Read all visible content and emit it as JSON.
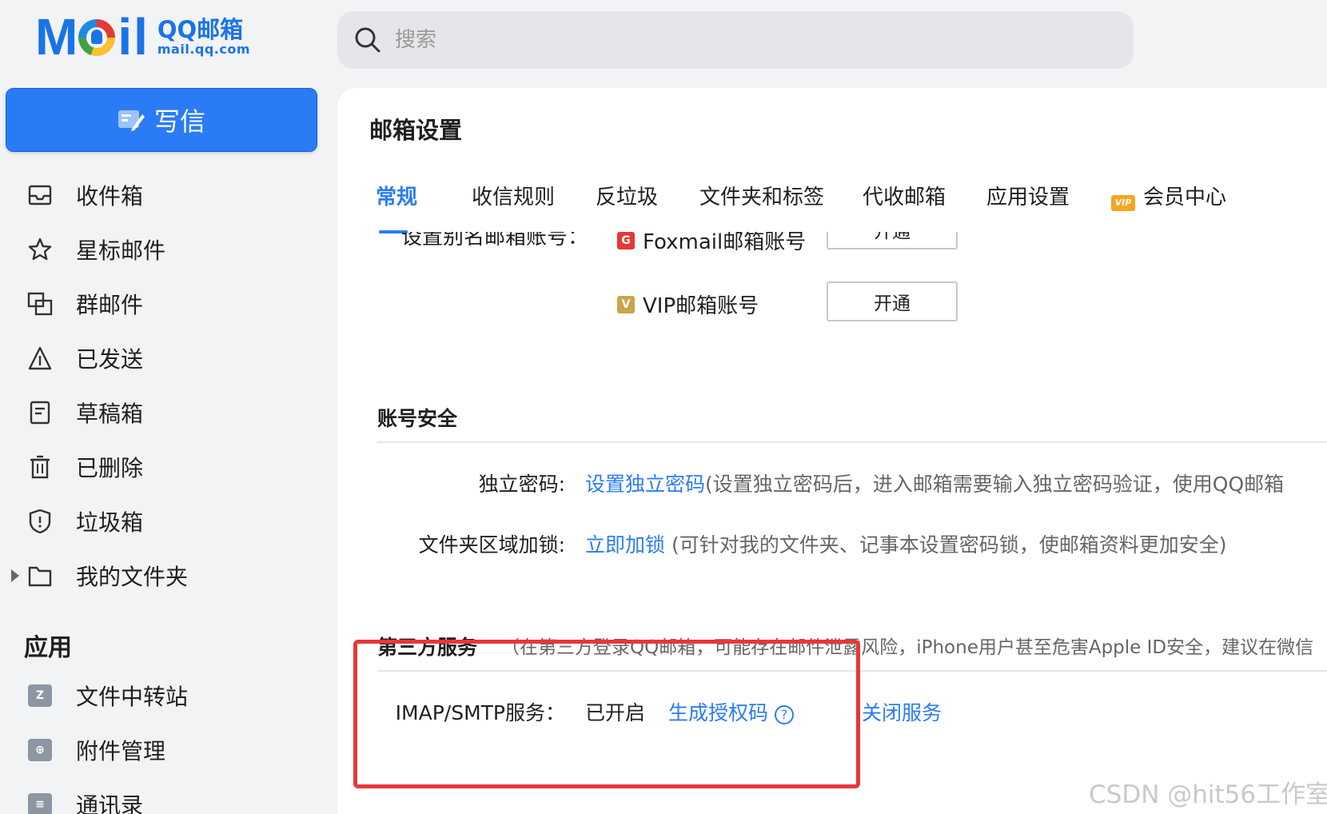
{
  "logo": {
    "letters_start": "M",
    "letters_end": "il",
    "brand": "QQ邮箱",
    "domain": "mail.qq.com"
  },
  "search": {
    "placeholder": "搜索"
  },
  "sidebar": {
    "compose_label": "写信",
    "items": [
      {
        "label": "收件箱",
        "icon": "inbox-icon"
      },
      {
        "label": "星标邮件",
        "icon": "star-icon"
      },
      {
        "label": "群邮件",
        "icon": "group-mail-icon"
      },
      {
        "label": "已发送",
        "icon": "sent-icon"
      },
      {
        "label": "草稿箱",
        "icon": "draft-icon"
      },
      {
        "label": "已删除",
        "icon": "trash-icon"
      },
      {
        "label": "垃圾箱",
        "icon": "spam-shield-icon"
      },
      {
        "label": "我的文件夹",
        "icon": "folder-icon"
      }
    ],
    "apps_title": "应用",
    "apps": [
      {
        "label": "文件中转站",
        "icon": "file-transfer-icon",
        "glyph": "Z"
      },
      {
        "label": "附件管理",
        "icon": "attachment-icon",
        "glyph": "⊕"
      },
      {
        "label": "通讯录",
        "icon": "contacts-icon",
        "glyph": "≡"
      }
    ]
  },
  "main": {
    "title": "邮箱设置",
    "tabs": [
      {
        "label": "常规",
        "active": true
      },
      {
        "label": "收信规则"
      },
      {
        "label": "反垃圾"
      },
      {
        "label": "文件夹和标签"
      },
      {
        "label": "代收邮箱"
      },
      {
        "label": "应用设置"
      },
      {
        "label": "会员中心",
        "badge": "VIP"
      }
    ],
    "alias": {
      "label_cut": "设置别名邮箱账号：",
      "foxmail_label": "Foxmail邮箱账号",
      "vip_label": "VIP邮箱账号",
      "open_label": "开通"
    },
    "security": {
      "title": "账号安全",
      "password_label": "独立密码:",
      "password_link": "设置独立密码",
      "password_note": "(设置独立密码后，进入邮箱需要输入独立密码验证，使用QQ邮箱",
      "lock_label": "文件夹区域加锁:",
      "lock_link": "立即加锁",
      "lock_note": "(可针对我的文件夹、记事本设置密码锁，使邮箱资料更加安全)"
    },
    "third_party": {
      "title": "第三方服务",
      "note": "（在第三方登录QQ邮箱，可能存在邮件泄露风险，iPhone用户甚至危害Apple ID安全，建议在微信",
      "imap_label": "IMAP/SMTP服务：",
      "status": "已开启",
      "gen_code_link": "生成授权码",
      "close_link": "关闭服务"
    }
  },
  "watermark": "CSDN @hit56工作室",
  "colors": {
    "accent": "#2a7cf6",
    "highlight": "#e5383b",
    "background": "#f2f3f5"
  }
}
